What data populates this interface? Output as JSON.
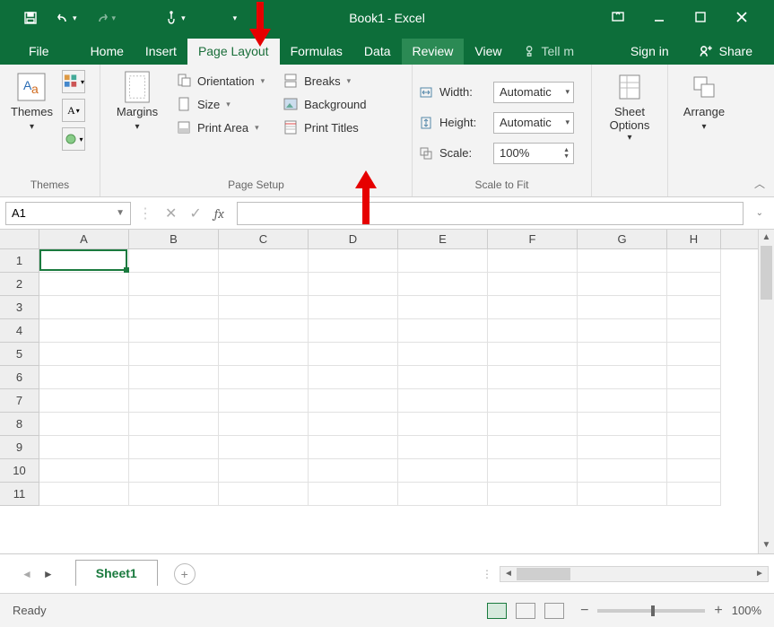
{
  "title": {
    "book": "Book1",
    "app": "Excel"
  },
  "tabs": {
    "file": "File",
    "home": "Home",
    "insert": "Insert",
    "pagelayout": "Page Layout",
    "formulas": "Formulas",
    "data": "Data",
    "review": "Review",
    "view": "View",
    "tellme": "Tell m",
    "signin": "Sign in",
    "share": "Share"
  },
  "ribbon": {
    "themes": {
      "main": "Themes",
      "group": "Themes"
    },
    "margins": "Margins",
    "orientation": "Orientation",
    "size": "Size",
    "printarea": "Print Area",
    "breaks": "Breaks",
    "background": "Background",
    "printtitles": "Print Titles",
    "pagesetup_group": "Page Setup",
    "width_lbl": "Width:",
    "height_lbl": "Height:",
    "scale_lbl": "Scale:",
    "width_val": "Automatic",
    "height_val": "Automatic",
    "scale_val": "100%",
    "scaletofit_group": "Scale to Fit",
    "sheetoptions": "Sheet\nOptions",
    "arrange": "Arrange"
  },
  "namebox": "A1",
  "columns": [
    "A",
    "B",
    "C",
    "D",
    "E",
    "F",
    "G",
    "H"
  ],
  "rows": [
    "1",
    "2",
    "3",
    "4",
    "5",
    "6",
    "7",
    "8",
    "9",
    "10",
    "11"
  ],
  "sheet": "Sheet1",
  "status": "Ready",
  "zoom": "100%"
}
